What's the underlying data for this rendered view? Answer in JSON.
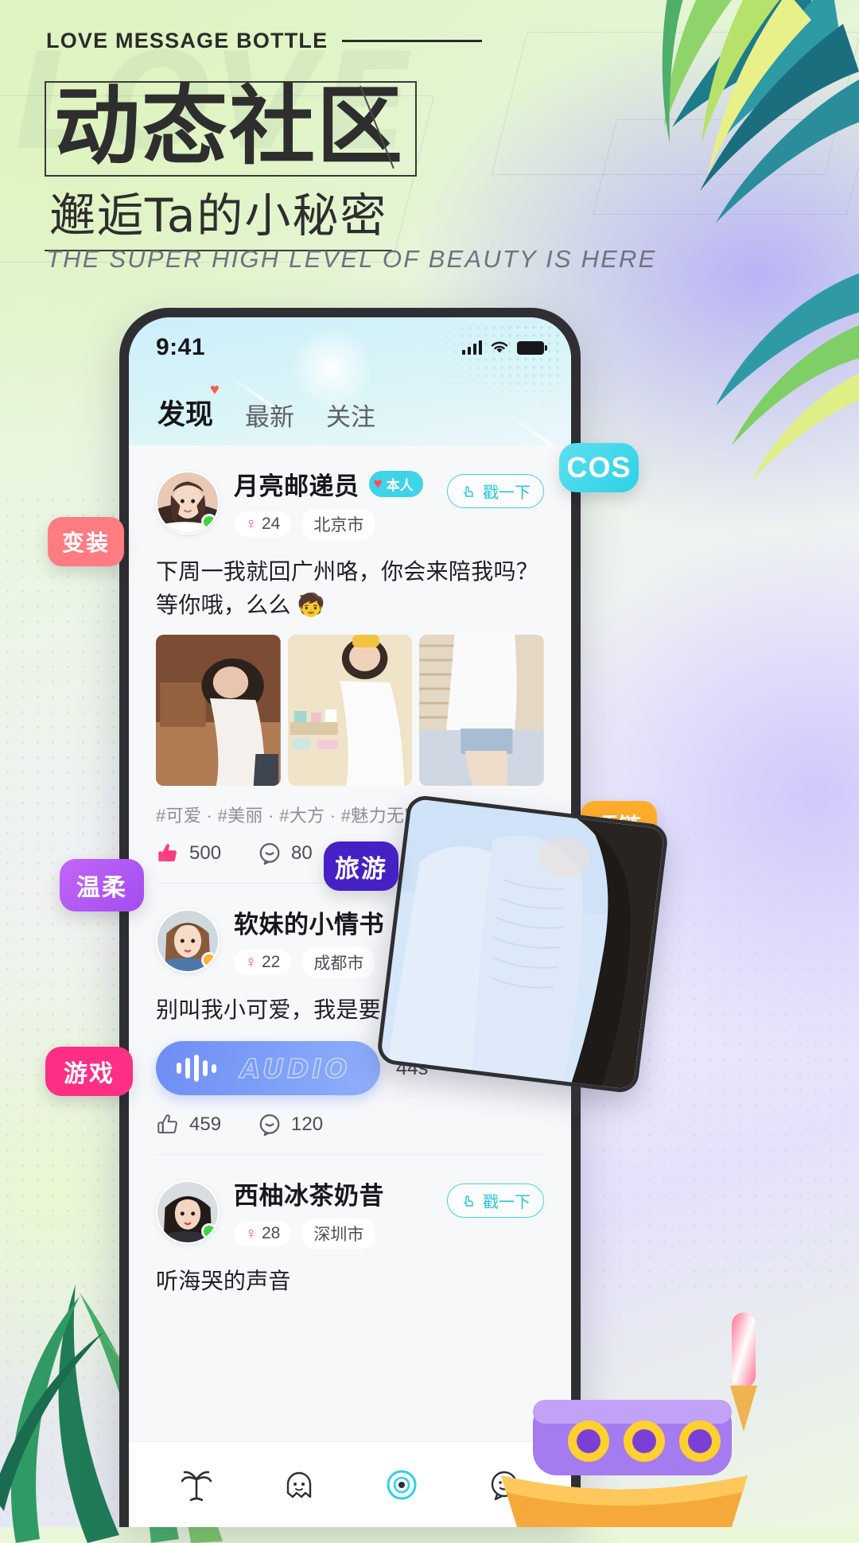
{
  "poster": {
    "kicker": "LOVE MESSAGE BOTTLE",
    "ghost_word": "LOVE",
    "title": "动态社区",
    "subtitle": "邂逅Ta的小秘密",
    "tagline": "THE SUPER HIGH LEVEL OF BEAUTY IS HERE"
  },
  "chips": [
    {
      "label": "变装",
      "color": "#ff7c83"
    },
    {
      "label": "温柔",
      "color": "#a24df0"
    },
    {
      "label": "游戏",
      "color": "#ff2f86"
    },
    {
      "label": "项链",
      "color": "#ffae2b"
    },
    {
      "label": "COS",
      "color": "#2fd0e6"
    },
    {
      "label": "旅游",
      "color": "#4520c4"
    }
  ],
  "phone": {
    "statusbar": {
      "time": "9:41",
      "signal_icon": "signal-bars-icon",
      "wifi_icon": "wifi-icon",
      "battery_icon": "battery-icon"
    },
    "tabs": [
      {
        "label": "发现",
        "active": true,
        "dot": true
      },
      {
        "label": "最新",
        "active": false,
        "dot": false
      },
      {
        "label": "关注",
        "active": false,
        "dot": false
      }
    ],
    "posts": [
      {
        "username": "月亮邮递员",
        "badge": "本人",
        "age": "24",
        "city": "北京市",
        "poke_label": "戳一下",
        "status_color": "#3fd442",
        "text": "下周一我就回广州咯，你会来陪我吗？等你哦，么么 🧒",
        "tags": "#可爱 · #美丽 · #大方 · #魅力无穷",
        "likes": "500",
        "comments": "80",
        "more_icon": "more-dots-icon"
      },
      {
        "username": "软妹的小情书",
        "age": "22",
        "city": "成都市",
        "status_color": "#ffb02e",
        "text": "别叫我小可爱，我是要成为女王的",
        "audio_label": "AUDIO",
        "audio_duration": "44s",
        "likes": "459",
        "comments": "120"
      },
      {
        "username": "西柚冰茶奶昔",
        "age": "28",
        "city": "深圳市",
        "poke_label": "戳一下",
        "status_color": "#3fd442",
        "text": "听海哭的声音"
      }
    ],
    "bottom_nav": [
      {
        "icon": "palm-tree-icon",
        "label": ""
      },
      {
        "icon": "ghost-face-icon",
        "label": ""
      },
      {
        "icon": "target-eye-icon",
        "label": ""
      },
      {
        "icon": "chat-face-icon",
        "label": ""
      }
    ]
  }
}
